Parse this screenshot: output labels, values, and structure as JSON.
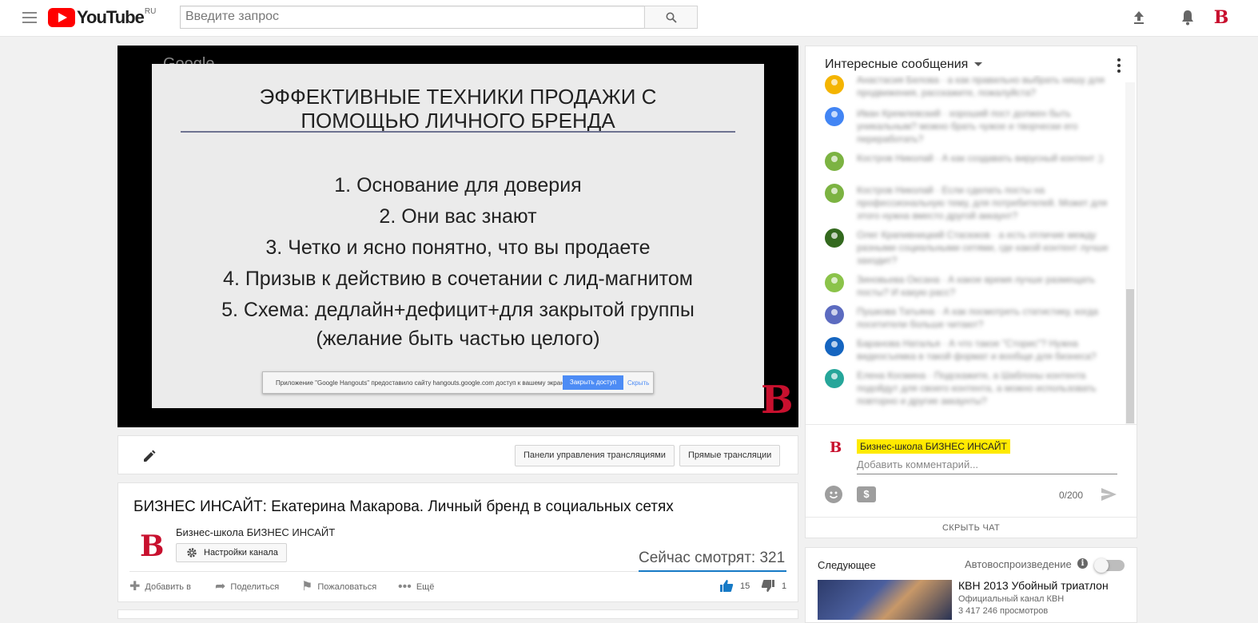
{
  "header": {
    "logo_text": "YouTube",
    "country": "RU",
    "search_placeholder": "Введите запрос",
    "avatar_letter": "B"
  },
  "player": {
    "background_brand": "Google",
    "slide_title": "ЭФФЕКТИВНЫЕ ТЕХНИКИ ПРОДАЖИ С ПОМОЩЬЮ ЛИЧНОГО БРЕНДА",
    "slide_items": [
      "1. Основание для доверия",
      "2. Они вас знают",
      "3. Четко и ясно понятно, что вы продаете",
      "4. Призыв к действию в сочетании с лид-магнитом",
      "5. Схема: дедлайн+дефицит+для закрытой группы",
      "(желание быть частью целого)"
    ],
    "share_notice": "Приложение \"Google Hangouts\" предоставило сайту hangouts.google.com доступ к вашему экрану.",
    "share_stop_button": "Закрыть доступ",
    "share_hide_link": "Скрыть",
    "watermark": "B"
  },
  "edit_bar": {
    "dashboard_button": "Панели управления трансляциями",
    "live_button": "Прямые трансляции"
  },
  "video": {
    "title": "БИЗНЕС ИНСАЙТ: Екатерина Макарова. Личный бренд в социальных сетях",
    "channel_logo": "B",
    "channel_name": "Бизнес-школа БИЗНЕС ИНСАЙТ",
    "channel_settings": "Настройки канала",
    "viewers": "Сейчас смотрят: 321",
    "actions": {
      "add_to": "Добавить в",
      "share": "Поделиться",
      "report": "Пожаловаться",
      "more": "Ещё"
    },
    "likes": "15",
    "dislikes": "1"
  },
  "chat": {
    "title": "Интересные сообщения",
    "messages": [
      {
        "text": "Анастасия Белова · а как правильно выбрать нишу для продвижения, расскажите, пожалуйста?",
        "color": "#f4b400"
      },
      {
        "text": "Иван Кремлевский · хороший пост должен быть уникальным? можно брать чужое и творчески его переработать?",
        "color": "#4285f4"
      },
      {
        "text": "Костров Николай · А как создавать вирусный контент ;)",
        "color": "#7cb342"
      },
      {
        "text": "Костров Николай · Если сделать посты на профессиональную тему, для потребителей. Может для этого нужна вместо другой аккаунт?",
        "color": "#7cb342"
      },
      {
        "text": "Олег Крапивницкий Стасюков · а есть отличие между разными социальными сетями, где какой контент лучше заходит?",
        "color": "#33691e"
      },
      {
        "text": "Зиновьева Оксана · А какое время лучше размещать посты? И какую расс?",
        "color": "#8bc34a"
      },
      {
        "text": "Пушкова Татьяна · А как посмотреть статистику, когда посетители больше читают?",
        "color": "#5c6bc0"
      },
      {
        "text": "Баранова Наталья · А что такое \"Сторис\"? Нужна видеосъемка в такой формат и вообще для бизнеса?",
        "color": "#1565c0"
      },
      {
        "text": "Елена Космина · Подскажите, а Шаблоны контента подойдут для своего контента, а можно использовать повторно и другие аккаунты?",
        "color": "#26a69a"
      }
    ],
    "author_logo": "B",
    "author_name": "Бизнес-школа БИЗНЕС ИНСАЙТ",
    "input_placeholder": "Добавить комментарий...",
    "superchat_icon": "$",
    "counter": "0/200",
    "hide_chat": "СКРЫТЬ ЧАТ"
  },
  "upnext": {
    "label": "Следующее",
    "autoplay_label": "Автовоспроизведение",
    "info_icon": "i",
    "video_title": "КВН 2013 Убойный триатлон",
    "video_channel": "Официальный канал КВН",
    "video_views": "3 417 246 просмотров"
  },
  "colors": {
    "youtube_red": "#ff0000",
    "brand_red": "#c8102e",
    "highlight_yellow": "#ffea00",
    "progress_blue": "#167ac6"
  }
}
